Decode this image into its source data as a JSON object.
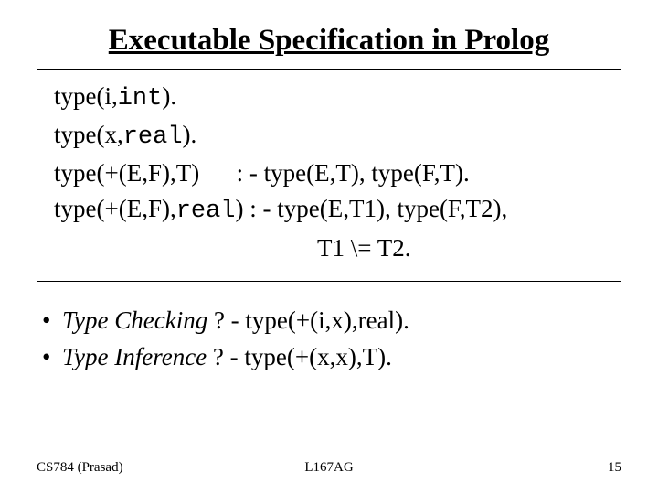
{
  "title": "Executable Specification in Prolog",
  "code": {
    "l1a": "type(i,",
    "l1b": "int",
    "l1c": ").",
    "l2a": "type(x,",
    "l2b": "real",
    "l2c": ").",
    "l3": "type(+(E,F),T)      : - type(E,T), type(F,T).",
    "l4a": "type(+(E,F),",
    "l4b": "real",
    "l4c": ") : - type(E,T1), type(F,T2),",
    "l5": "T1 \\= T2."
  },
  "bullets": {
    "b1_ital": "Type Checking",
    "b1_rest": " ? - type(+(i,x),real).",
    "b2_ital": "Type Inference",
    "b2_rest": " ? - type(+(x,x),T)."
  },
  "footer": {
    "left": "CS784 (Prasad)",
    "center": "L167AG",
    "right": "15"
  }
}
